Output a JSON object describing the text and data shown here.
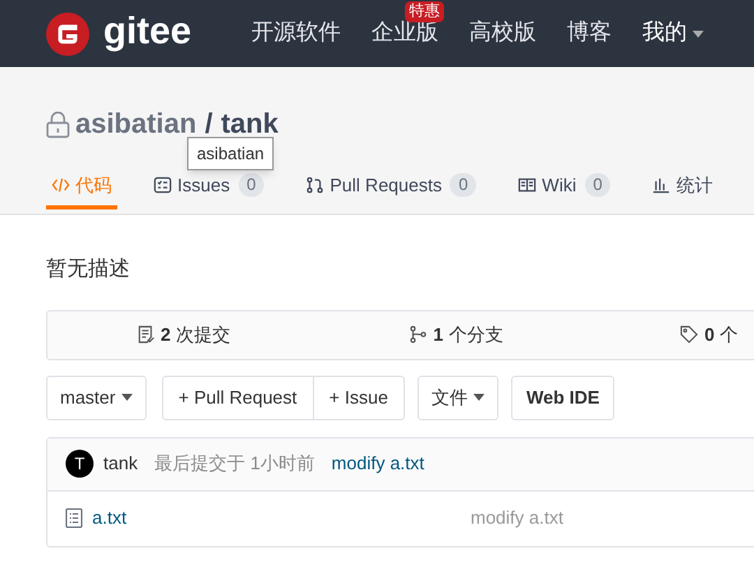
{
  "navbar": {
    "logo_text": "gitee",
    "items": [
      {
        "label": "开源软件",
        "dropdown": false
      },
      {
        "label": "企业版",
        "badge": "特惠",
        "dropdown": false
      },
      {
        "label": "高校版",
        "dropdown": false
      },
      {
        "label": "博客",
        "dropdown": false
      },
      {
        "label": "我的",
        "dropdown": true
      }
    ]
  },
  "repo": {
    "owner": "asibatian",
    "separator": "/",
    "name": "tank",
    "private": true
  },
  "tooltip": "asibatian",
  "tabs": [
    {
      "kind": "code",
      "label": "代码",
      "selected": true
    },
    {
      "kind": "issues",
      "label": "Issues",
      "count": "0",
      "selected": false
    },
    {
      "kind": "pulls",
      "label": "Pull Requests",
      "count": "0",
      "selected": false
    },
    {
      "kind": "wiki",
      "label": "Wiki",
      "count": "0",
      "selected": false
    },
    {
      "kind": "stats",
      "label": "统计",
      "selected": false
    }
  ],
  "description": "暂无描述",
  "stats": [
    {
      "kind": "commits",
      "number": "2",
      "label": "次提交"
    },
    {
      "kind": "branches",
      "number": "1",
      "label": "个分支"
    },
    {
      "kind": "tags",
      "number": "0",
      "label": "个"
    }
  ],
  "toolbar": {
    "branch": "master",
    "actions": [
      "+ Pull Request",
      "+ Issue"
    ],
    "file_menu": "文件",
    "web_ide": "Web IDE"
  },
  "last_commit": {
    "avatar": "T",
    "author": "tank",
    "time": "最后提交于 1小时前",
    "message": "modify a.txt"
  },
  "files": [
    {
      "name": "a.txt",
      "message": "modify a.txt"
    }
  ]
}
